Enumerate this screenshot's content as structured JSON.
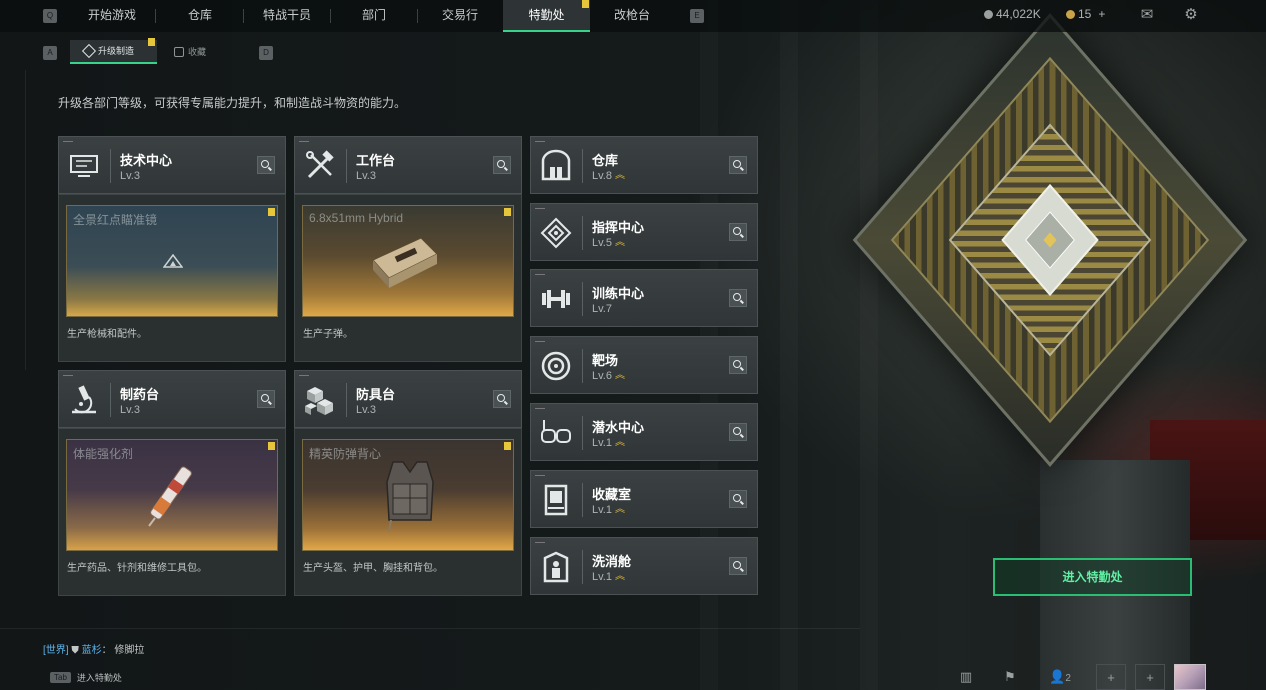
{
  "nav": {
    "left_key": "Q",
    "right_key": "E",
    "tabs": [
      {
        "label": "开始游戏"
      },
      {
        "label": "仓库"
      },
      {
        "label": "特战干员"
      },
      {
        "label": "部门"
      },
      {
        "label": "交易行"
      },
      {
        "label": "特勤处"
      },
      {
        "label": "改枪台"
      }
    ],
    "active_tab": "特勤处",
    "currency_primary": "44,022K",
    "currency_secondary": "15",
    "add_symbol": "+",
    "mail_icon": "mail-icon",
    "settings_icon": "gear-icon"
  },
  "subnav": {
    "left_key": "A",
    "right_key": "D",
    "tabs": [
      {
        "label": "升级制造"
      },
      {
        "label": "收藏"
      }
    ],
    "active_tab": "升级制造"
  },
  "description": "升级各部门等级，可获得专属能力提升，和制造战斗物资的能力。",
  "production_cards": [
    {
      "name": "技术中心",
      "level": "Lv.3",
      "icon": "computer-icon",
      "preview_item": "全景红点瞄准镜",
      "footer": "生产枪械和配件。"
    },
    {
      "name": "工作台",
      "level": "Lv.3",
      "icon": "tools-icon",
      "preview_item": "6.8x51mm Hybrid",
      "footer": "生产子弹。"
    },
    {
      "name": "制药台",
      "level": "Lv.3",
      "icon": "microscope-icon",
      "preview_item": "体能强化剂",
      "footer": "生产药品、针剂和维修工具包。"
    },
    {
      "name": "防具台",
      "level": "Lv.3",
      "icon": "cubes-icon",
      "preview_item": "精英防弹背心",
      "footer": "生产头盔、护甲、胸挂和背包。"
    }
  ],
  "facilities": [
    {
      "name": "仓库",
      "level": "Lv.8",
      "upgradable": true,
      "icon": "warehouse-icon"
    },
    {
      "name": "指挥中心",
      "level": "Lv.5",
      "upgradable": true,
      "icon": "command-icon"
    },
    {
      "name": "训练中心",
      "level": "Lv.7",
      "upgradable": false,
      "icon": "dumbbell-icon"
    },
    {
      "name": "靶场",
      "level": "Lv.6",
      "upgradable": true,
      "icon": "target-icon"
    },
    {
      "name": "潜水中心",
      "level": "Lv.1",
      "upgradable": true,
      "icon": "diving-mask-icon"
    },
    {
      "name": "收藏室",
      "level": "Lv.1",
      "upgradable": true,
      "icon": "display-case-icon"
    },
    {
      "name": "洗消舱",
      "level": "Lv.1",
      "upgradable": true,
      "icon": "decon-chamber-icon"
    }
  ],
  "enter_button": "进入特勤处",
  "chat": {
    "channel": "[世界]",
    "user": "蓝杉",
    "message": "修脚拉"
  },
  "tab_hint": {
    "key": "Tab",
    "label": "进入特勤处"
  },
  "bottom_bar": {
    "party_count": "2"
  },
  "colors": {
    "accent": "#37d38a",
    "warning": "#e6c63a",
    "upgrade": "#e3b83a"
  }
}
